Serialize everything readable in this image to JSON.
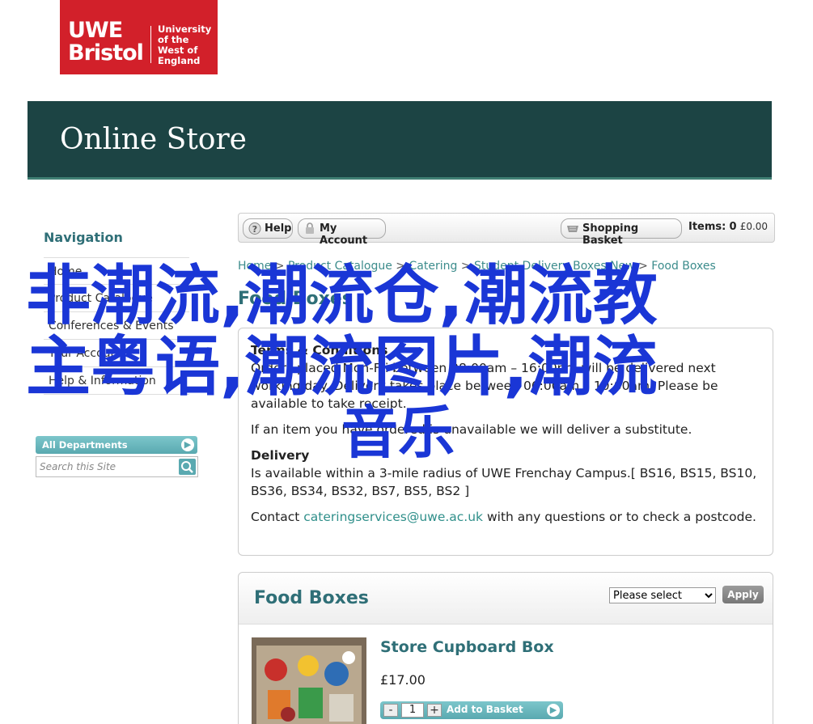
{
  "logo": {
    "uwe": "UWE",
    "bristol": "Bristol",
    "university_lines": [
      "University",
      "of the",
      "West of",
      "England"
    ]
  },
  "banner": {
    "title": "Online Store"
  },
  "navigation": {
    "title": "Navigation",
    "items": [
      "Home",
      "Product Catalogue",
      "Conferences & Events",
      "Your Account",
      "Help & Information"
    ]
  },
  "departments": {
    "label": "All Departments",
    "search_placeholder": "Search this Site"
  },
  "toolbar": {
    "help": "Help",
    "account": "My Account",
    "basket": "Shopping Basket",
    "items_label": "Items:",
    "items_count": "0",
    "items_total": "£0.00"
  },
  "breadcrumbs": [
    "Home",
    "Product Catalogue",
    "Catering",
    "Student Delivery Boxes New",
    "Food Boxes"
  ],
  "page_heading": "Food Boxes",
  "info": {
    "terms_heading": "Terms & Conditions",
    "terms_text": "Orders placed Mon-Fri between 08:00am – 16:00pm will be delivered next working day. Delivery takes place between 06:00am – 10:00am. Please be available to take receipt.",
    "substitute_text": "If an item you have ordered is unavailable we will deliver a substitute.",
    "delivery_heading": "Delivery",
    "delivery_text": "Is available within a 3-mile radius of UWE Frenchay Campus.[ BS16, BS15, BS10, BS36, BS34, BS32, BS7, BS5, BS2 ]",
    "contact_prefix": "Contact",
    "contact_email": "cateringservices@uwe.ac.uk",
    "contact_suffix": "with any questions or to check a postcode."
  },
  "panel": {
    "title": "Food Boxes",
    "select_value": "Please select",
    "apply": "Apply"
  },
  "product": {
    "name": "Store Cupboard Box",
    "price": "£17.00",
    "quantity": "1",
    "add_label": "Add to Basket"
  },
  "overlay": {
    "line1": "非潮流,潮流仓,潮流教",
    "line2": "主粤语,潮流图片,潮流",
    "line3": "音乐"
  },
  "colors": {
    "brand_red": "#d2202a",
    "banner": "#1c4444",
    "accent_teal": "#2f6f77",
    "overlay_blue": "#1a36d6"
  }
}
